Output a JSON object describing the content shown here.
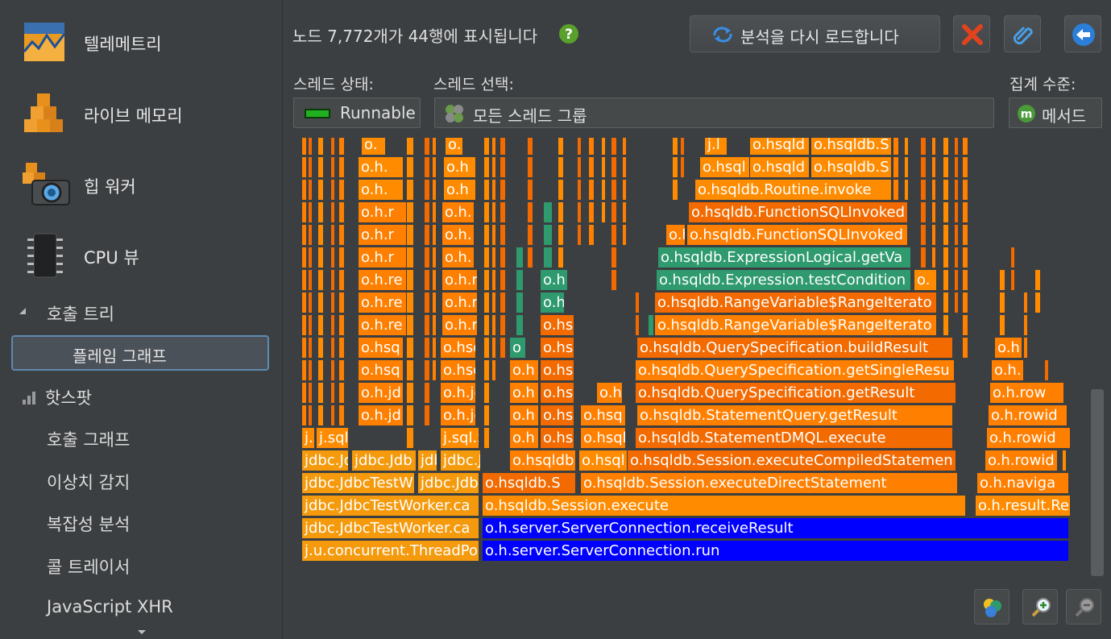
{
  "sidebar": {
    "items": [
      {
        "label": "텔레메트리",
        "icon": "telemetry-icon"
      },
      {
        "label": "라이브 메모리",
        "icon": "live-memory-icon"
      },
      {
        "label": "힙 워커",
        "icon": "heap-walker-icon"
      },
      {
        "label": "CPU 뷰",
        "icon": "cpu-icon"
      }
    ],
    "call_tree": {
      "label": "호출 트리",
      "icon": "triangle-down-icon"
    },
    "flame_graph": "플레임 그래프",
    "hotspots": {
      "label": "핫스팟",
      "icon": "bar-chart-icon"
    },
    "sub_items": [
      "호출 그래프",
      "이상치 감지",
      "복잡성 분석",
      "콜 트레이서",
      "JavaScript XHR"
    ],
    "more_icon": "chevron-down-icon"
  },
  "header": {
    "info": "노드 7,772개가 44행에 표시됩니다",
    "help_icon": "help-icon",
    "reload_label": "분석을 다시 로드합니다",
    "reload_icon": "reload-icon",
    "close_icon": "close-icon",
    "attach_icon": "paperclip-icon",
    "back_icon": "back-arrow-icon"
  },
  "filters": {
    "thread_state_label": "스레드 상태:",
    "thread_state_value": "Runnable",
    "thread_select_label": "스레드 선택:",
    "thread_select_value": "모든 스레드 그룹",
    "aggregation_label": "집계 수준:",
    "aggregation_value": "메서드"
  },
  "colors": {
    "orange": "#ff7f00",
    "dark_orange": "#f26a00",
    "light_orange": "#ff9a1a",
    "amber": "#f49a0c",
    "green": "#2e9a6e",
    "blue": "#0000ff",
    "background": "#3c3f41"
  },
  "flame_frames": [
    {
      "row": 0,
      "text": "j.u.concurrent.ThreadPo",
      "color": "#f49a0c"
    },
    {
      "row": 0,
      "text": "o.h.server.ServerConnection.run",
      "color": "#0000ff"
    },
    {
      "row": 1,
      "text": "jdbc.JdbcTestWorker.ca",
      "color": "#f49a0c"
    },
    {
      "row": 1,
      "text": "o.h.server.ServerConnection.receiveResult",
      "color": "#0000ff"
    },
    {
      "row": 2,
      "text": "jdbc.JdbcTestWorker.ca",
      "color": "#f49a0c"
    },
    {
      "row": 2,
      "text": "o.hsqldb.Session.execute",
      "color": "#ff8c00"
    },
    {
      "row": 2,
      "text": "o.h.result.Re",
      "color": "#ff8c00"
    },
    {
      "row": 3,
      "text": "jdbc.JdbcTestW",
      "color": "#f49a0c"
    },
    {
      "row": 3,
      "text": "jdbc.Jdb",
      "color": "#f49a0c"
    },
    {
      "row": 3,
      "text": "o.hsqldb.S",
      "color": "#f26a00"
    },
    {
      "row": 3,
      "text": "o.hsqldb.Session.executeDirectStatement",
      "color": "#ff7f00"
    },
    {
      "row": 3,
      "text": "o.h.naviga",
      "color": "#ff7f00"
    },
    {
      "row": 4,
      "text": "jdbc.Jd",
      "color": "#f49a0c"
    },
    {
      "row": 4,
      "text": "jdbc.Jdb",
      "color": "#f49a0c"
    },
    {
      "row": 4,
      "text": "jdb",
      "color": "#f49a0c"
    },
    {
      "row": 4,
      "text": "jdbc.J",
      "color": "#f49a0c"
    },
    {
      "row": 4,
      "text": "o.hsqldb",
      "color": "#ff7f00"
    },
    {
      "row": 4,
      "text": "o.hsql",
      "color": "#ff8c00"
    },
    {
      "row": 4,
      "text": "o.hsqldb.Session.executeCompiledStatemen",
      "color": "#f26a00"
    },
    {
      "row": 4,
      "text": "o.h.rowid",
      "color": "#ff7f00"
    },
    {
      "row": 5,
      "text": "j.s",
      "color": "#ff8c00"
    },
    {
      "row": 5,
      "text": "j.sql.S",
      "color": "#ff8c00"
    },
    {
      "row": 5,
      "text": "j.sql.S",
      "color": "#ff8c00"
    },
    {
      "row": 5,
      "text": "o.h",
      "color": "#ff7f00"
    },
    {
      "row": 5,
      "text": "o.hs",
      "color": "#f26a00"
    },
    {
      "row": 5,
      "text": "o.hsql",
      "color": "#ff7f00"
    },
    {
      "row": 5,
      "text": "o.hsqldb.StatementDMQL.execute",
      "color": "#f26a00"
    },
    {
      "row": 5,
      "text": "o.h.rowid",
      "color": "#ff7f00"
    },
    {
      "row": 6,
      "text": "o.h.jd",
      "color": "#ff7f00"
    },
    {
      "row": 6,
      "text": "o.h.jd",
      "color": "#ff7f00"
    },
    {
      "row": 6,
      "text": "o.h",
      "color": "#ff7f00"
    },
    {
      "row": 6,
      "text": "o.hs",
      "color": "#f26a00"
    },
    {
      "row": 6,
      "text": "o.hsq",
      "color": "#ff7f00"
    },
    {
      "row": 6,
      "text": "o.hsqldb.StatementQuery.getResult",
      "color": "#ff7f00"
    },
    {
      "row": 6,
      "text": "o.h.rowid",
      "color": "#ff7f00"
    },
    {
      "row": 7,
      "text": "o.h.jd",
      "color": "#ff7f00"
    },
    {
      "row": 7,
      "text": "o.h.jd",
      "color": "#ff7f00"
    },
    {
      "row": 7,
      "text": "o.h",
      "color": "#ff7f00"
    },
    {
      "row": 7,
      "text": "o.hs",
      "color": "#f26a00"
    },
    {
      "row": 7,
      "text": "o.h",
      "color": "#ff7f00"
    },
    {
      "row": 7,
      "text": "o.hsqldb.QuerySpecification.getResult",
      "color": "#f26a00"
    },
    {
      "row": 7,
      "text": "o.h.row",
      "color": "#ff7f00"
    },
    {
      "row": 8,
      "text": "o.hsq",
      "color": "#ff7f00"
    },
    {
      "row": 8,
      "text": "o.hsq",
      "color": "#ff7f00"
    },
    {
      "row": 8,
      "text": "o.h",
      "color": "#ff7f00"
    },
    {
      "row": 8,
      "text": "o.hs",
      "color": "#f26a00"
    },
    {
      "row": 8,
      "text": "o.hsqldb.QuerySpecification.getSingleResu",
      "color": "#ff7f00"
    },
    {
      "row": 8,
      "text": "o.h.",
      "color": "#ff7f00"
    },
    {
      "row": 9,
      "text": "o.hsq",
      "color": "#ff7f00"
    },
    {
      "row": 9,
      "text": "o.hsq",
      "color": "#ff7f00"
    },
    {
      "row": 9,
      "text": "o",
      "color": "#2e9a6e"
    },
    {
      "row": 9,
      "text": "o.hs",
      "color": "#f26a00"
    },
    {
      "row": 9,
      "text": "o.hsqldb.QuerySpecification.buildResult",
      "color": "#f26a00"
    },
    {
      "row": 9,
      "text": "o.h",
      "color": "#ff7f00"
    },
    {
      "row": 10,
      "text": "o.h.re",
      "color": "#ff7f00"
    },
    {
      "row": 10,
      "text": "o.h.r",
      "color": "#ff7f00"
    },
    {
      "row": 10,
      "text": "o.hs",
      "color": "#f26a00"
    },
    {
      "row": 10,
      "text": "o.hsqldb.RangeVariable$RangeIterato",
      "color": "#ff7f00"
    },
    {
      "row": 11,
      "text": "o.h.re",
      "color": "#ff7f00"
    },
    {
      "row": 11,
      "text": "o.h.r",
      "color": "#ff7f00"
    },
    {
      "row": 11,
      "text": "o.h",
      "color": "#2e9a6e"
    },
    {
      "row": 11,
      "text": "o.hsqldb.RangeVariable$RangeIterato",
      "color": "#f26a00"
    },
    {
      "row": 12,
      "text": "o.h.re",
      "color": "#ff7f00"
    },
    {
      "row": 12,
      "text": "o.h.r",
      "color": "#ff7f00"
    },
    {
      "row": 12,
      "text": "o.h",
      "color": "#2e9a6e"
    },
    {
      "row": 12,
      "text": "o.hsqldb.Expression.testCondition",
      "color": "#2e9a6e"
    },
    {
      "row": 12,
      "text": "o.",
      "color": "#ff8c00"
    },
    {
      "row": 13,
      "text": "o.h.r",
      "color": "#ff7f00"
    },
    {
      "row": 13,
      "text": "o.h.",
      "color": "#ff7f00"
    },
    {
      "row": 13,
      "text": "o.hsqldb.ExpressionLogical.getVa",
      "color": "#2e9a6e"
    },
    {
      "row": 14,
      "text": "o.h.r",
      "color": "#ff7f00"
    },
    {
      "row": 14,
      "text": "o.h.",
      "color": "#ff7f00"
    },
    {
      "row": 14,
      "text": "o.h",
      "color": "#ff7f00"
    },
    {
      "row": 14,
      "text": "o.hsqldb.FunctionSQLInvoked",
      "color": "#ff7f00"
    },
    {
      "row": 15,
      "text": "o.h.r",
      "color": "#ff7f00"
    },
    {
      "row": 15,
      "text": "o.h.",
      "color": "#ff7f00"
    },
    {
      "row": 15,
      "text": "o.hsqldb.FunctionSQLInvoked",
      "color": "#f26a00"
    },
    {
      "row": 16,
      "text": "o.h.",
      "color": "#ff8c00"
    },
    {
      "row": 16,
      "text": "o.h",
      "color": "#ff8c00"
    },
    {
      "row": 16,
      "text": "o.hsqldb.Routine.invoke",
      "color": "#ff8c00"
    },
    {
      "row": 17,
      "text": "o.h.",
      "color": "#ff8c00"
    },
    {
      "row": 17,
      "text": "o.h",
      "color": "#ff8c00"
    },
    {
      "row": 17,
      "text": "o.hsql",
      "color": "#ff8c00"
    },
    {
      "row": 17,
      "text": "o.hsqld",
      "color": "#ff8c00"
    },
    {
      "row": 17,
      "text": "o.hsqldb.S",
      "color": "#ff8c00"
    },
    {
      "row": 18,
      "text": "o.",
      "color": "#ff8c00"
    },
    {
      "row": 18,
      "text": "o.",
      "color": "#ff8c00"
    },
    {
      "row": 18,
      "text": "j.l",
      "color": "#ff8c00"
    },
    {
      "row": 18,
      "text": "o.hsqld",
      "color": "#ff8c00"
    },
    {
      "row": 18,
      "text": "o.hsqldb.S",
      "color": "#ff8c00"
    }
  ],
  "bottom_buttons": {
    "colors_icon": "color-palette-icon",
    "zoom_in_icon": "zoom-in-icon",
    "zoom_out_icon": "zoom-out-icon"
  }
}
